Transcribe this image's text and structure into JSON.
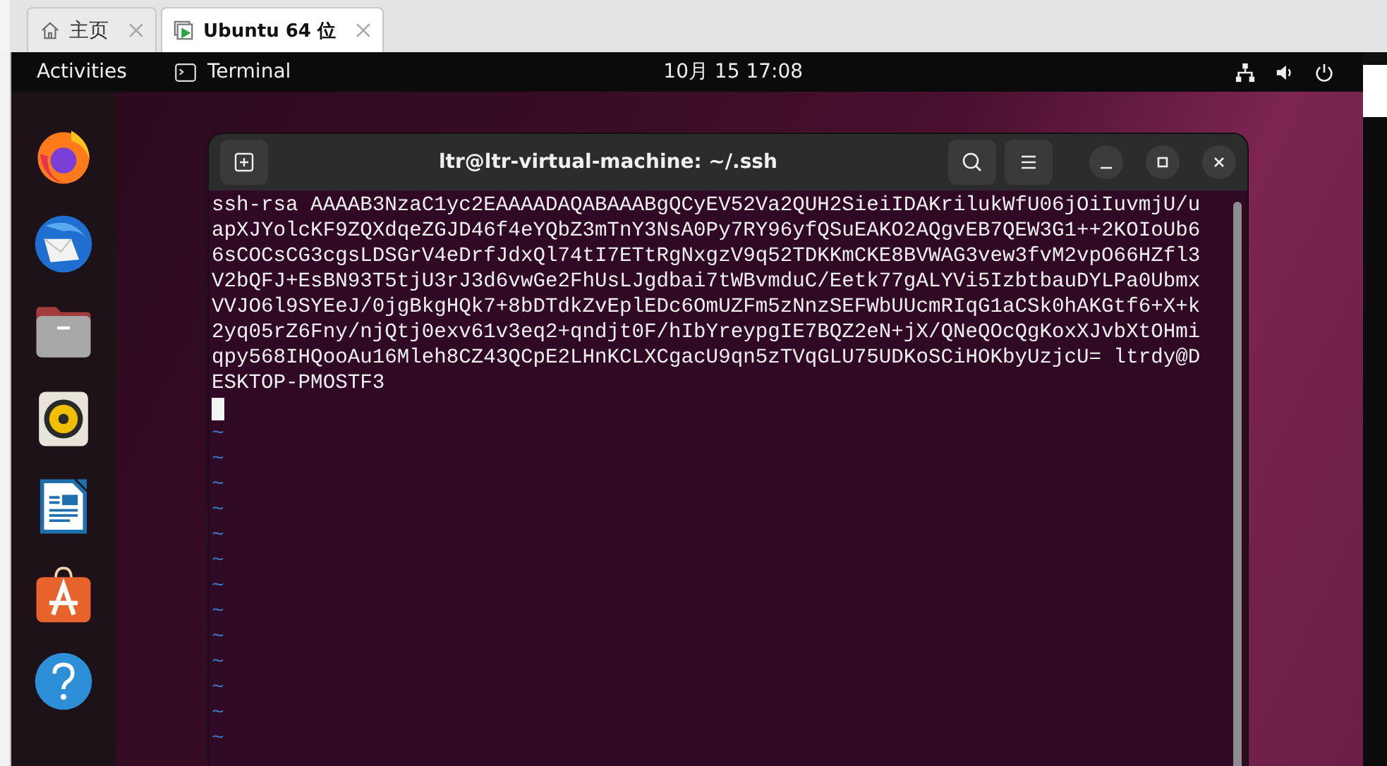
{
  "vm_tabs": [
    {
      "label": "主页",
      "kind": "home",
      "selected": false
    },
    {
      "label": "Ubuntu 64 位",
      "kind": "vm",
      "selected": true
    }
  ],
  "top_bar": {
    "activities": "Activities",
    "app": "Terminal",
    "clock": "10月 15  17:08"
  },
  "dock": [
    {
      "kind": "browser"
    },
    {
      "kind": "mail"
    },
    {
      "kind": "files"
    },
    {
      "kind": "music"
    },
    {
      "kind": "writer"
    },
    {
      "kind": "store"
    },
    {
      "kind": "help"
    }
  ],
  "terminal": {
    "title": "ltr@ltr-virtual-machine: ~/.ssh",
    "lines": [
      "ssh-rsa AAAAB3NzaC1yc2EAAAADAQABAAABgQCyEV52Va2QUH2SieiIDAKrilukWfU06jOiIuvmjU/u",
      "apXJYolcKF9ZQXdqeZGJD46f4eYQbZ3mTnY3NsA0Py7RY96yfQSuEAKO2AQgvEB7QEW3G1++2KOIoUb6",
      "6sCOCsCG3cgsLDSGrV4eDrfJdxQl74tI7ETtRgNxgzV9q52TDKKmCKE8BVWAG3vew3fvM2vpO66HZfl3",
      "V2bQFJ+EsBN93T5tjU3rJ3d6vwGe2FhUsLJgdbai7tWBvmduC/Eetk77gALYVi5IzbtbauDYLPa0Ubmx",
      "VVJO6l9SYEeJ/0jgBkgHQk7+8bDTdkZvEplEDc6OmUZFm5zNnzSEFWbUUcmRIqG1aCSk0hAKGtf6+X+k",
      "2yq05rZ6Fny/njQtj0exv61v3eq2+qndjt0F/hIbYreypgIE7BQZ2eN+jX/QNeQOcQgKoxXJvbXtOHmi",
      "qpy568IHQooAu16Mleh8CZ43QCpE2LHnKCLXCgacU9qn5zTVqGLU75UDKoSCiHOKbyUzjcU= ltrdy@D",
      "ESKTOP-PMOSTF3"
    ],
    "cursor_visible": true,
    "empty_lines": [
      "~",
      "~",
      "~",
      "~",
      "~",
      "~",
      "~",
      "~",
      "~",
      "~",
      "~",
      "~",
      "~"
    ]
  }
}
